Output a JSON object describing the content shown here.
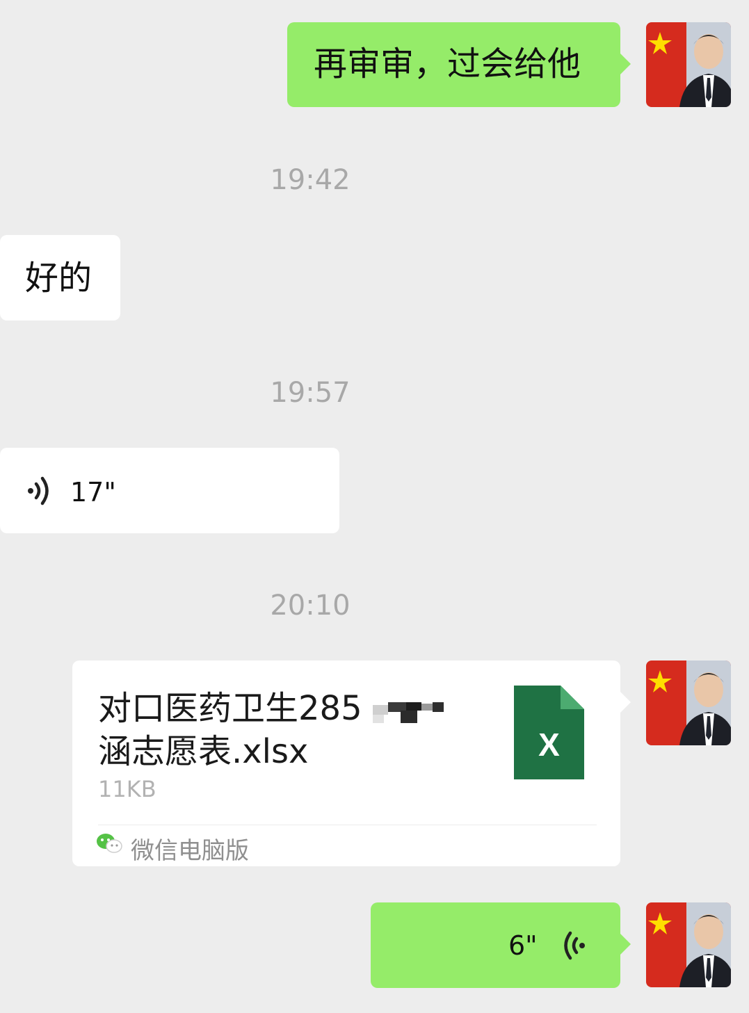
{
  "messages": {
    "m1": {
      "text": "再审审，过会给他"
    },
    "t1": "19:42",
    "m2": {
      "text": "好的"
    },
    "t2": "19:57",
    "m3": {
      "duration": "17\""
    },
    "t3": "20:10",
    "m4": {
      "file_name_line1": "对口医药卫生285",
      "file_name_line2": "涵志愿表.xlsx",
      "file_size": "11KB",
      "source": "微信电脑版",
      "file_type_letter": "X"
    },
    "m5": {
      "duration": "6\""
    }
  },
  "colors": {
    "background": "#ededed",
    "outgoing_bubble": "#95ec69",
    "incoming_bubble": "#ffffff",
    "timestamp": "#a8a8a8",
    "excel_green": "#1f7244"
  },
  "icons": [
    "voice-playback-icon",
    "excel-file-icon",
    "wechat-logo-icon",
    "user-avatar"
  ]
}
